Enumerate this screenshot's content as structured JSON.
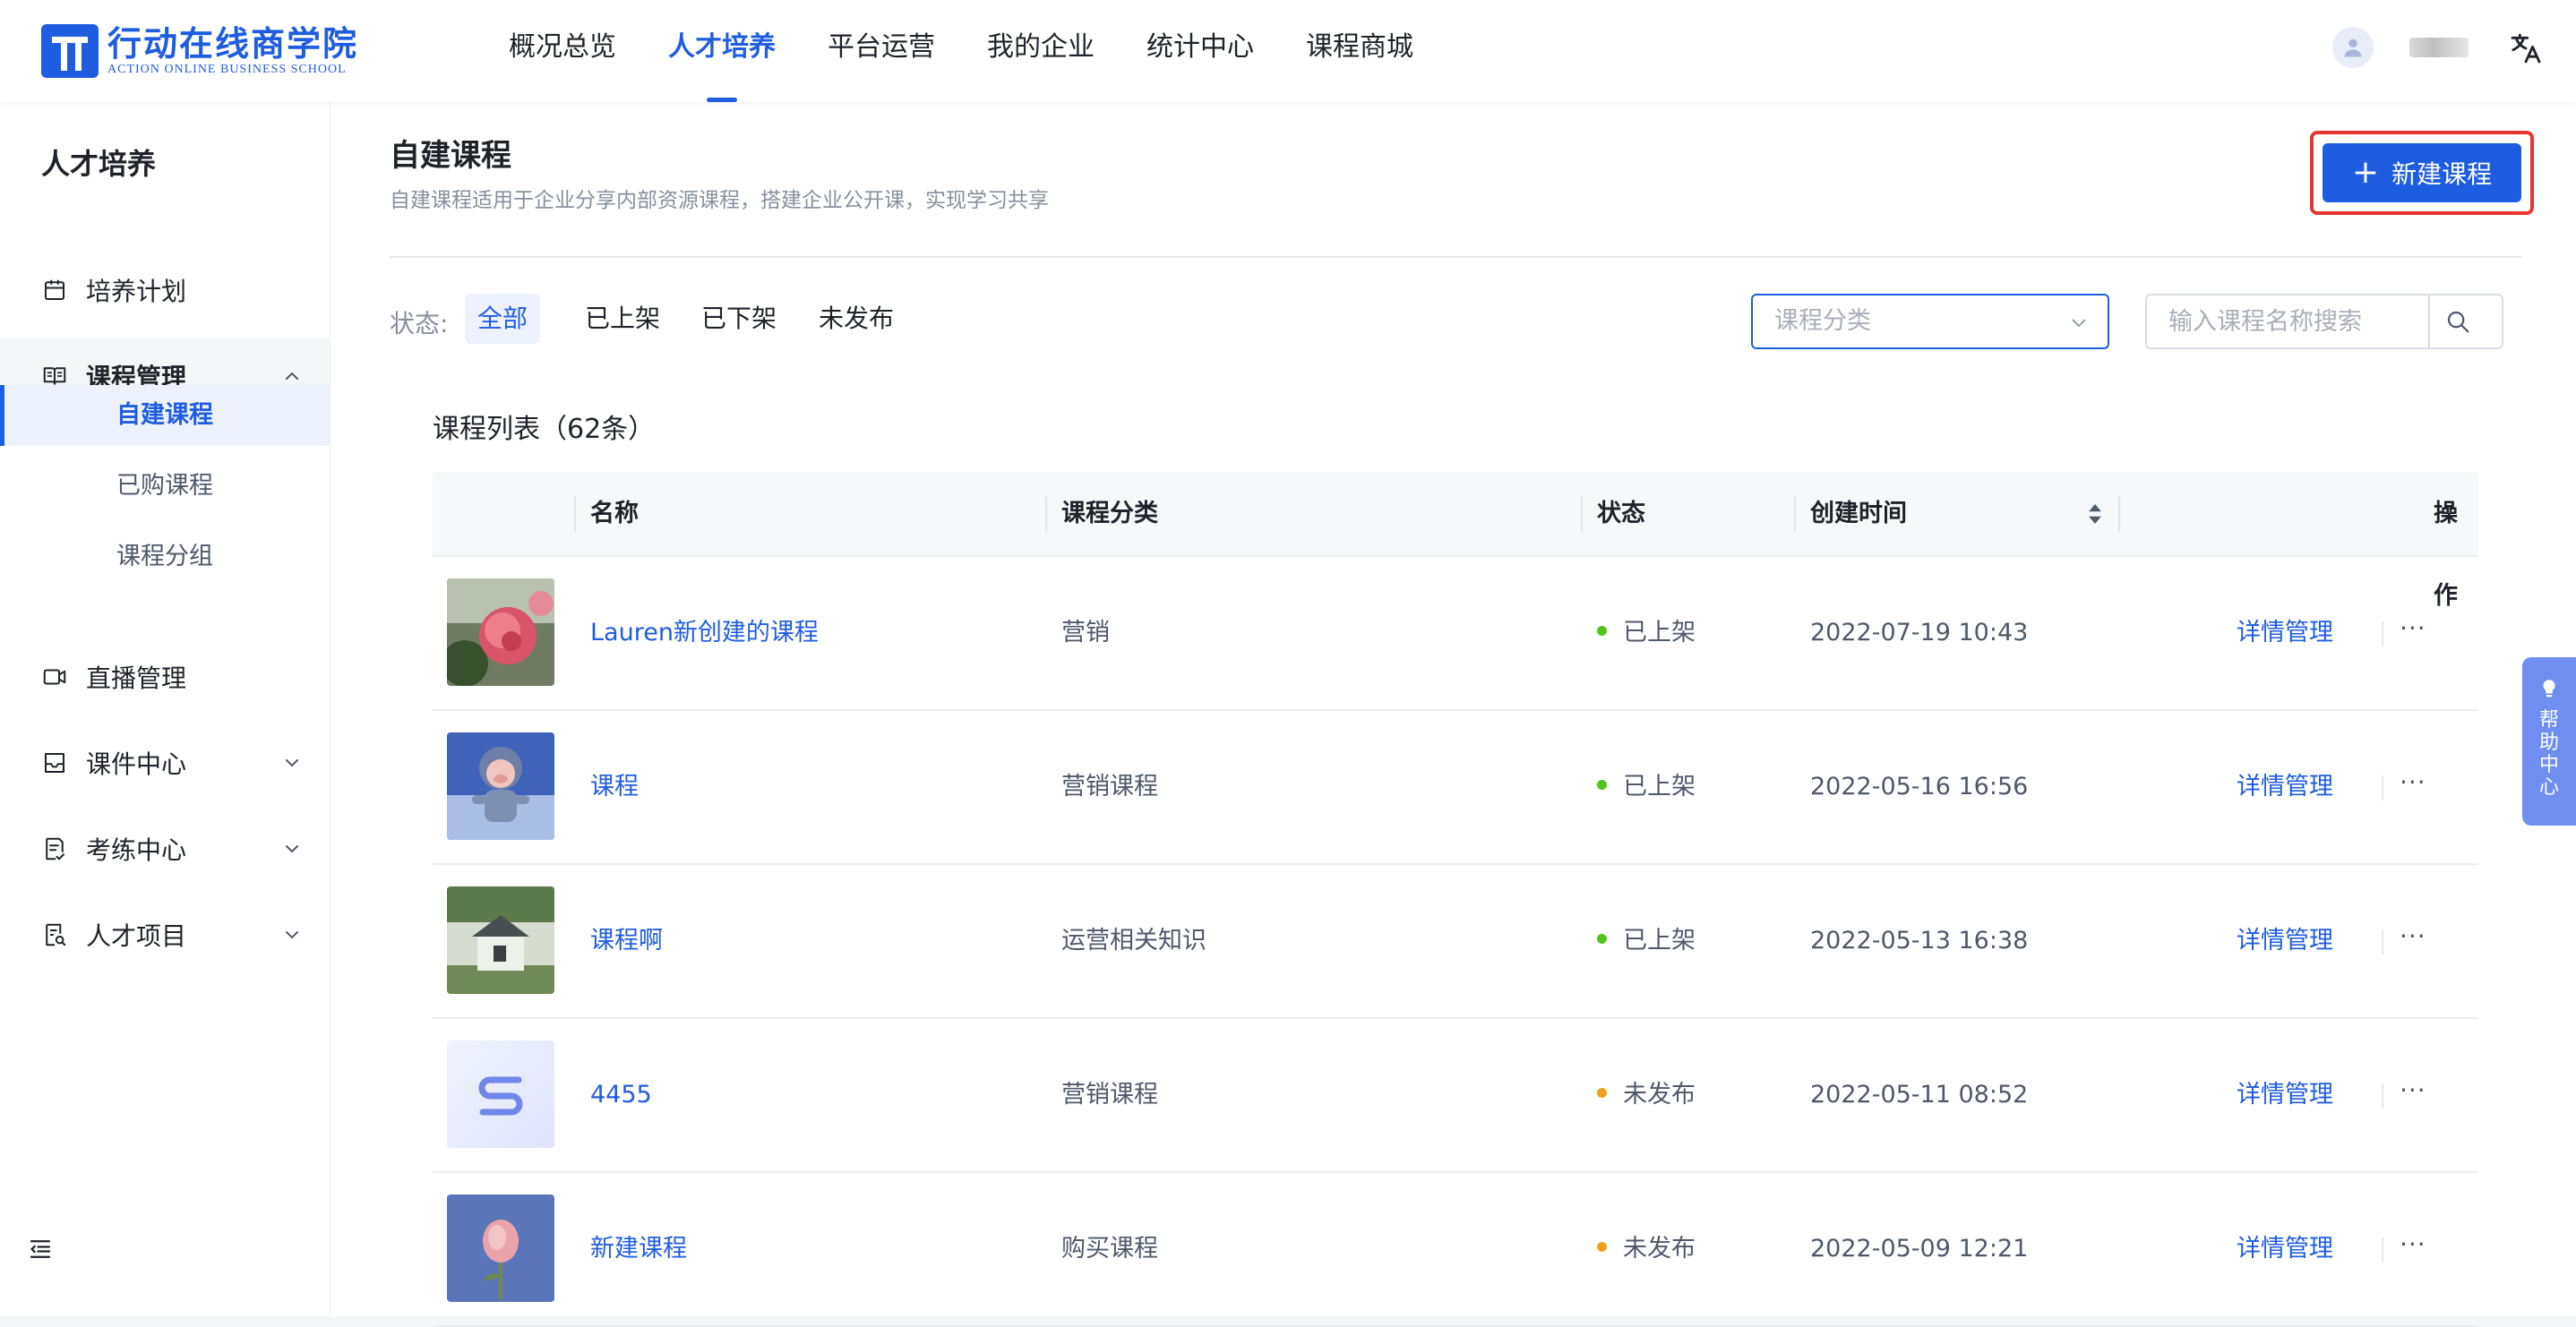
{
  "header": {
    "logo_cn": "行动在线商学院",
    "logo_en": "ACTION ONLINE BUSINESS SCHOOL",
    "nav": [
      {
        "label": "概况总览",
        "active": false
      },
      {
        "label": "人才培养",
        "active": true
      },
      {
        "label": "平台运营",
        "active": false
      },
      {
        "label": "我的企业",
        "active": false
      },
      {
        "label": "统计中心",
        "active": false
      },
      {
        "label": "课程商城",
        "active": false
      }
    ]
  },
  "sidebar": {
    "title": "人才培养",
    "items": [
      {
        "label": "培养计划",
        "icon": "calendar-icon"
      },
      {
        "label": "课程管理",
        "icon": "book-icon",
        "expanded": true
      },
      {
        "label": "直播管理",
        "icon": "video-camera-icon"
      },
      {
        "label": "课件中心",
        "icon": "inbox-icon",
        "expanded": false
      },
      {
        "label": "考练中心",
        "icon": "exam-icon",
        "expanded": false
      },
      {
        "label": "人才项目",
        "icon": "talent-project-icon",
        "expanded": false
      }
    ],
    "sub_items": [
      {
        "label": "自建课程",
        "active": true
      },
      {
        "label": "已购课程",
        "active": false
      },
      {
        "label": "课程分组",
        "active": false
      }
    ]
  },
  "main": {
    "title": "自建课程",
    "description": "自建课程适用于企业分享内部资源课程，搭建企业公开课，实现学习共享",
    "new_button": "新建课程",
    "status_label": "状态:",
    "status_tabs": [
      {
        "label": "全部",
        "active": true
      },
      {
        "label": "已上架",
        "active": false
      },
      {
        "label": "已下架",
        "active": false
      },
      {
        "label": "未发布",
        "active": false
      }
    ],
    "category_placeholder": "课程分类",
    "search_placeholder": "输入课程名称搜索",
    "list_title": "课程列表（62条）",
    "columns": {
      "name": "名称",
      "category": "课程分类",
      "status": "状态",
      "created": "创建时间",
      "actions": "操作"
    },
    "rows": [
      {
        "name": "Lauren新创建的课程",
        "category": "营销",
        "status": "已上架",
        "status_color": "#52c41a",
        "created": "2022-07-19 10:43",
        "action": "详情管理",
        "more": "···",
        "thumb": "rose-photo"
      },
      {
        "name": "课程",
        "category": "营销课程",
        "status": "已上架",
        "status_color": "#52c41a",
        "created": "2022-05-16 16:56",
        "action": "详情管理",
        "more": "···",
        "thumb": "pig-toy-photo"
      },
      {
        "name": "课程啊",
        "category": "运营相关知识",
        "status": "已上架",
        "status_color": "#52c41a",
        "created": "2022-05-13 16:38",
        "action": "详情管理",
        "more": "···",
        "thumb": "house-photo"
      },
      {
        "name": "4455",
        "category": "营销课程",
        "status": "未发布",
        "status_color": "#f0a020",
        "created": "2022-05-11 08:52",
        "action": "详情管理",
        "more": "···",
        "thumb": "s-logo-placeholder"
      },
      {
        "name": "新建课程",
        "category": "购买课程",
        "status": "未发布",
        "status_color": "#f0a020",
        "created": "2022-05-09 12:21",
        "action": "详情管理",
        "more": "···",
        "thumb": "pink-flower-photo"
      }
    ]
  },
  "help": {
    "label": "帮助中心"
  },
  "colors": {
    "brand": "#1f5de0",
    "highlight_border": "#e5372f",
    "online": "#52c41a",
    "unpublished": "#f0a020"
  }
}
